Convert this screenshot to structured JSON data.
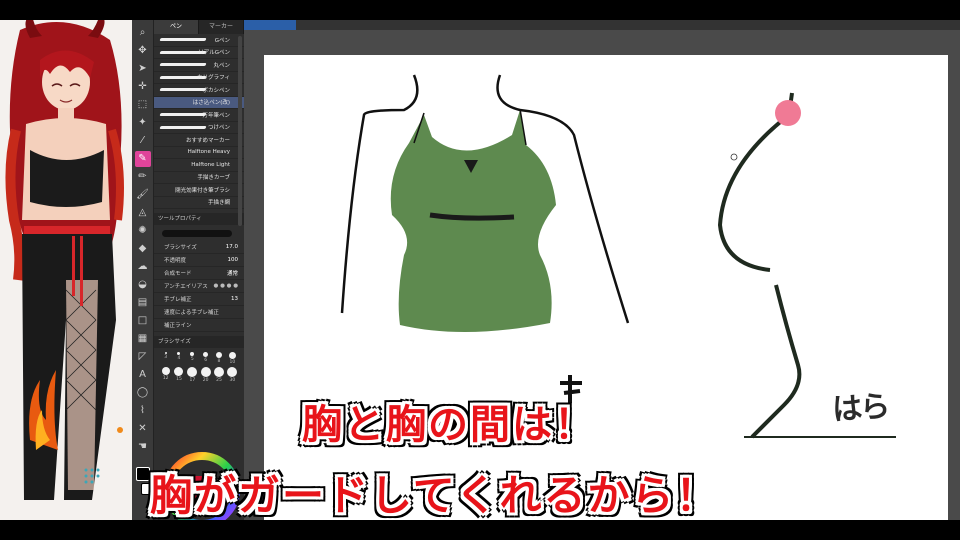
{
  "brush_panel": {
    "tabs": [
      {
        "label": "ペン"
      },
      {
        "label": "マーカー"
      }
    ],
    "brushes": [
      {
        "label": "Gペン"
      },
      {
        "label": "リアルGペン"
      },
      {
        "label": "丸ペン"
      },
      {
        "label": "カリグラフィ"
      },
      {
        "label": "ボカシペン"
      },
      {
        "label": "はさ込ペン(改)",
        "selected": true
      },
      {
        "label": "万年筆ペン"
      },
      {
        "label": "つけペン"
      },
      {
        "label": "おすすめマーカー"
      },
      {
        "label": "Halftone Heavy"
      },
      {
        "label": "Halftone Light"
      },
      {
        "label": "手描きカーブ"
      },
      {
        "label": "閉光効果付き筆ブラシ"
      },
      {
        "label": "手描き網"
      }
    ],
    "property_header": "ツールプロパティ",
    "properties": [
      {
        "label": "ブラシサイズ",
        "value": "17.0"
      },
      {
        "label": "不透明度",
        "value": "100"
      },
      {
        "label": "合成モード",
        "value": "通常"
      },
      {
        "label": "アンチエイリアス",
        "value": ""
      },
      {
        "label": "手ブレ補正",
        "value": "13"
      },
      {
        "label": "速度による手ブレ補正",
        "value": ""
      },
      {
        "label": "補正ライン",
        "value": ""
      }
    ],
    "size_header": "ブラシサイズ",
    "sizes": [
      "3",
      "4",
      "5",
      "6",
      "8",
      "10",
      "12",
      "15",
      "17",
      "20",
      "25",
      "30"
    ]
  },
  "canvas": {
    "annotation": "はら"
  },
  "subtitles": {
    "line1": "胸と胸の間は！",
    "line2": "胸がガードしてくれるから！"
  },
  "colors": {
    "shirt_green": "#5e8a4f",
    "selection_blue": "#4a5a80",
    "accent_pink": "#e0449a",
    "subtitle_red": "#e8141a"
  }
}
